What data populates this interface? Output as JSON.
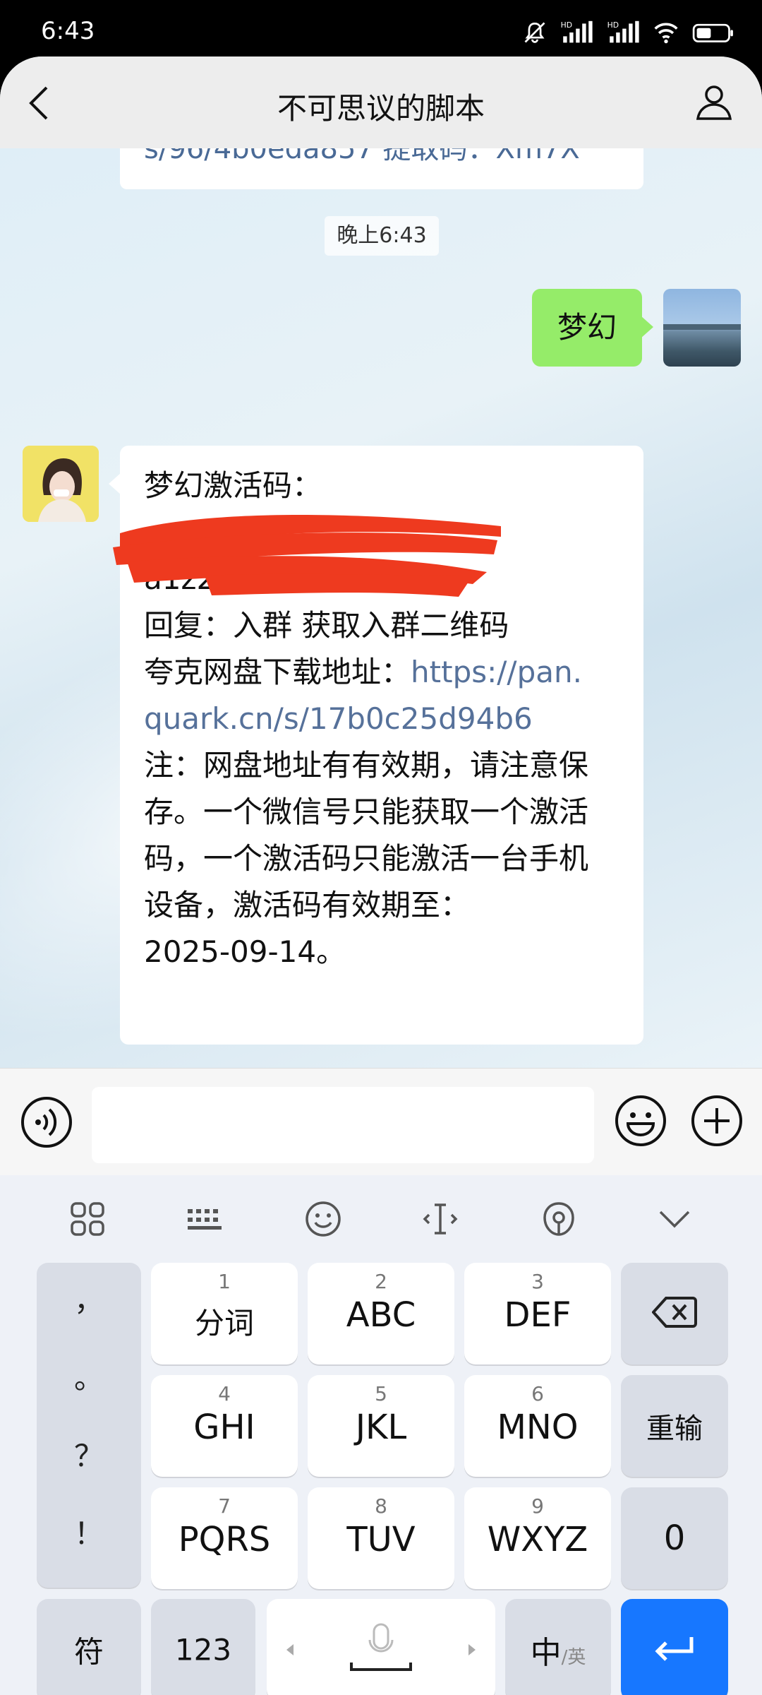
{
  "status_bar": {
    "time": "6:43",
    "icons": [
      "mute-icon",
      "hd-signal-icon",
      "hd-signal-icon",
      "wifi-icon",
      "battery-icon"
    ],
    "hd_label": "HD"
  },
  "header": {
    "title": "不可思议的脚本",
    "back_icon": "chevron-left-icon",
    "profile_icon": "person-icon"
  },
  "chat": {
    "previous_message_fragment": "s/96/4b0eda857 提取码：Xm7X",
    "timestamp": "晚上6:43",
    "sent_message": "梦幻",
    "received_message": {
      "line1": "梦幻激活码：",
      "line4": "回复：入群 获取入群二维码",
      "line5_prefix": "夸克网盘下载地址：",
      "line5_link": "https://pan.",
      "line6_link": "quark.cn/s/17b0c25d94b6",
      "line7": "注：网盘地址有有效期，请注意保",
      "line8": "存。一个微信号只能获取一个激活",
      "line9": "码，一个激活码只能激活一台手机",
      "line10": "设备，激活码有效期至：",
      "line11": "2025-09-14。",
      "redacted_fragment": "a1z2"
    }
  },
  "input_bar": {
    "voice_icon": "voice-icon",
    "emoji_icon": "smiley-icon",
    "plus_icon": "plus-circle-icon",
    "value": ""
  },
  "keyboard": {
    "toolbar_icons": [
      "grid-icon",
      "keyboard-icon",
      "emoji-icon",
      "cursor-icon",
      "theme-icon",
      "chevron-down-icon"
    ],
    "punctuation": [
      "，",
      "。",
      "？",
      "！"
    ],
    "keys": [
      {
        "num": "1",
        "label": "分词"
      },
      {
        "num": "2",
        "label": "ABC"
      },
      {
        "num": "3",
        "label": "DEF"
      },
      {
        "num": "4",
        "label": "GHI"
      },
      {
        "num": "5",
        "label": "JKL"
      },
      {
        "num": "6",
        "label": "MNO"
      },
      {
        "num": "7",
        "label": "PQRS"
      },
      {
        "num": "8",
        "label": "TUV"
      },
      {
        "num": "9",
        "label": "WXYZ"
      }
    ],
    "backspace_icon": "backspace-icon",
    "retype": "重输",
    "zero": "0",
    "symbols": "符",
    "numbers": "123",
    "space_icon": "microphone-icon",
    "lang_main": "中",
    "lang_sub": "/英",
    "enter_icon": "enter-icon"
  }
}
